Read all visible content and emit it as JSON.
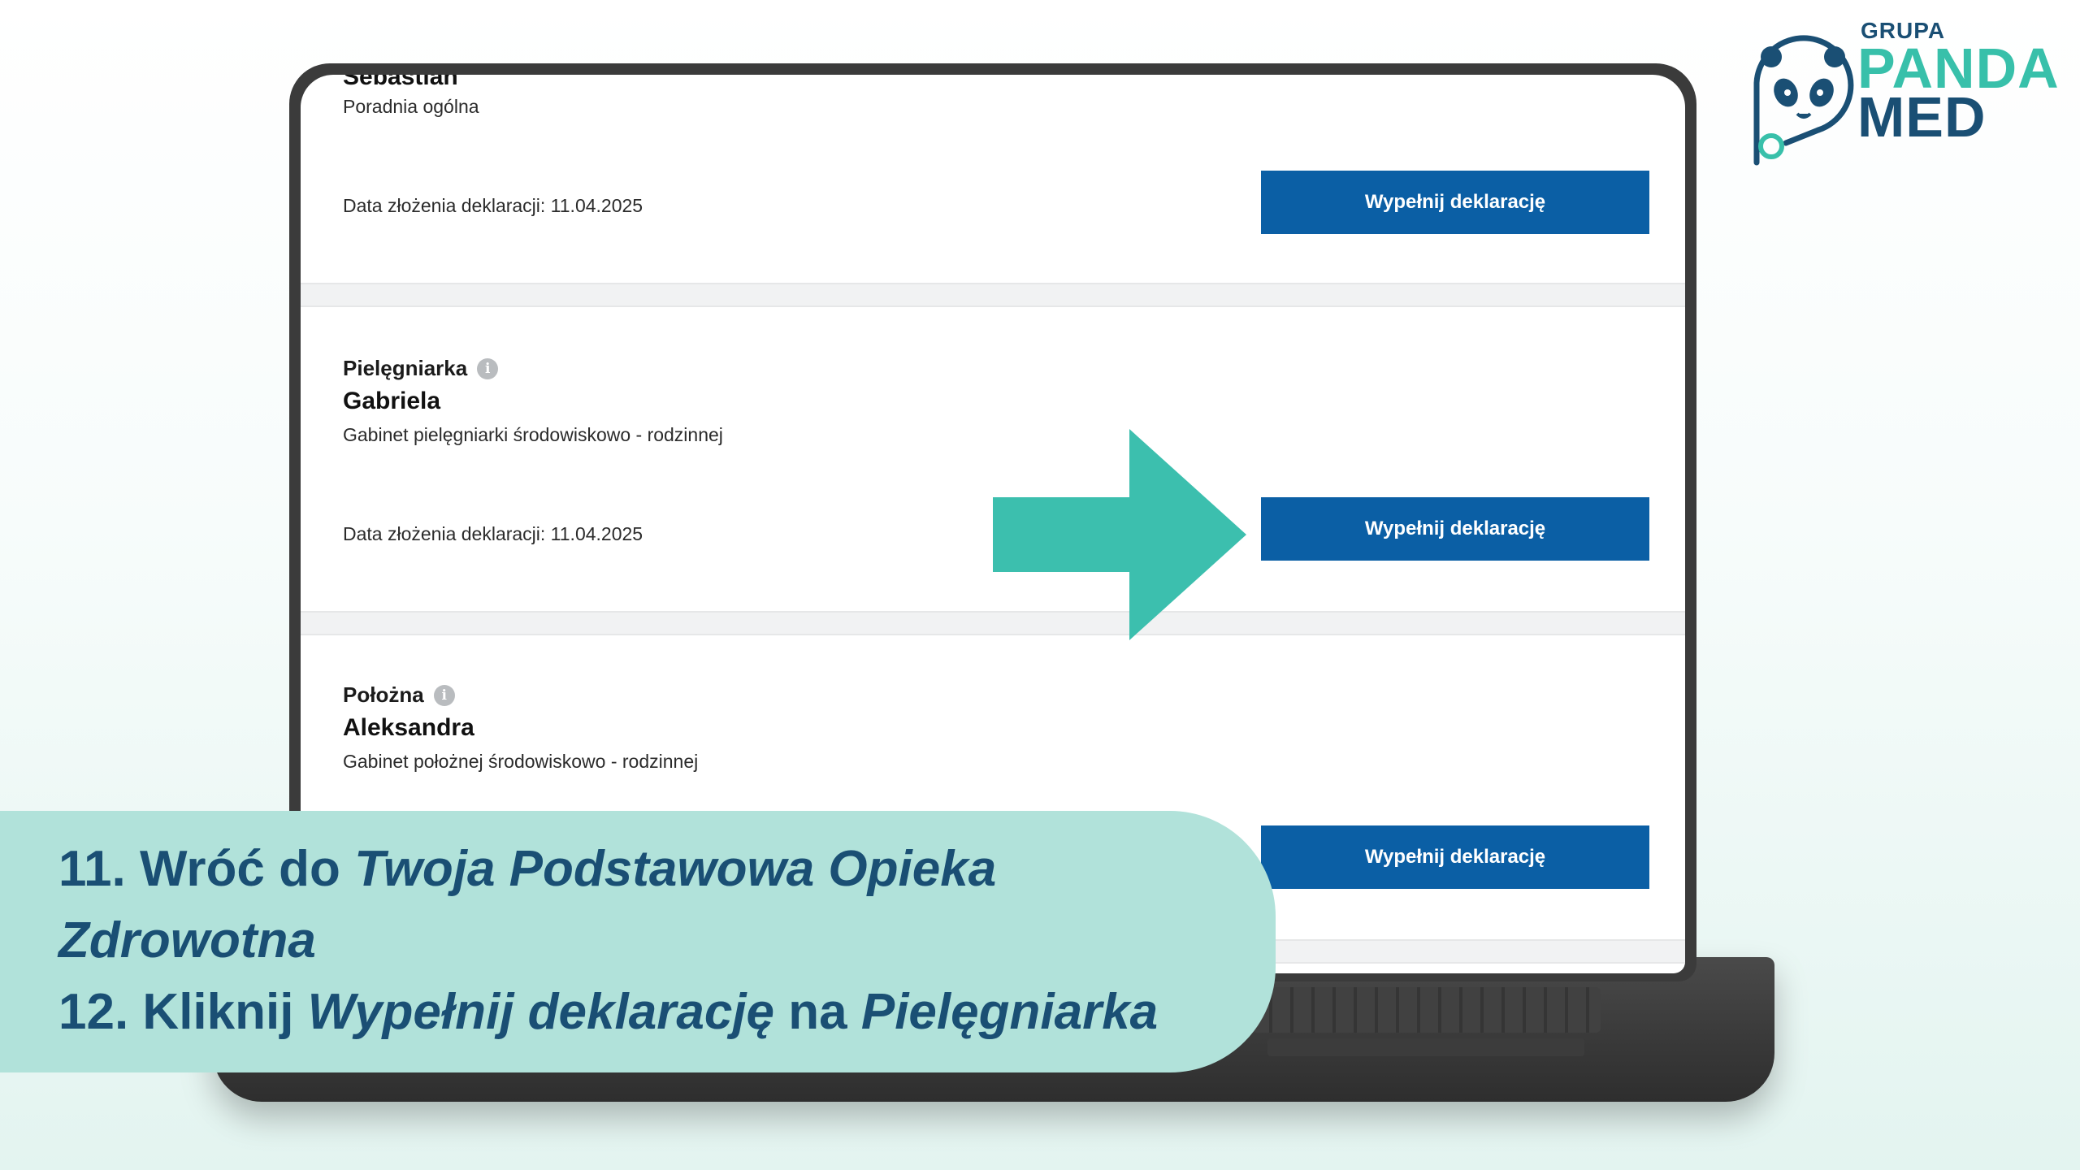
{
  "logo": {
    "grupa": "GRUPA",
    "panda": "PANDA",
    "med": "MED"
  },
  "cards": [
    {
      "name": "Sebastian",
      "clinic": "Poradnia ogólna",
      "date": "Data złożenia deklaracji: 11.04.2025",
      "button": "Wypełnij deklarację"
    },
    {
      "role": "Pielęgniarka",
      "name": "Gabriela",
      "clinic": "Gabinet pielęgniarki środowiskowo - rodzinnej",
      "date": "Data złożenia deklaracji: 11.04.2025",
      "button": "Wypełnij deklarację"
    },
    {
      "role": "Położna",
      "name": "Aleksandra",
      "clinic": "Gabinet położnej środowiskowo - rodzinnej",
      "button": "Wypełnij deklarację"
    }
  ],
  "caption": {
    "line1_prefix": "11. Wróć do ",
    "line1_italic": "Twoja Podstawowa Opieka",
    "line2_italic": "Zdrowotna",
    "line3_prefix": "12. Kliknij ",
    "line3_italic1": "Wypełnij deklarację",
    "line3_mid": " na ",
    "line3_italic2": "Pielęgniarka"
  },
  "colors": {
    "button": "#0b5fa5",
    "arrow": "#3cbfae",
    "caption_bg": "#b1e2da",
    "caption_text": "#1a4f74",
    "logo_teal": "#38c0aa",
    "logo_navy": "#1a4f74"
  },
  "icons": {
    "info": "info-icon",
    "arrow": "right-arrow-icon",
    "logo": "panda-stethoscope-logo"
  }
}
